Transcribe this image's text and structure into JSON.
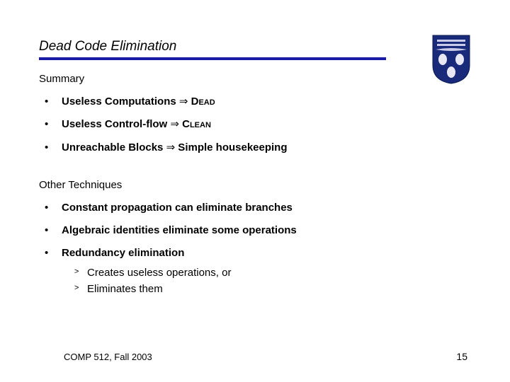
{
  "title": "Dead Code Elimination",
  "crest_label": "university-crest",
  "summary": {
    "heading": "Summary",
    "items": [
      {
        "lead": "Useless Computations ",
        "arrow": "⇒",
        "tail_sc": " Dead"
      },
      {
        "lead": "Useless Control-flow  ",
        "arrow": "⇒",
        "tail_sc": " Clean"
      },
      {
        "lead": "Unreachable Blocks  ",
        "arrow": "⇒",
        "tail": " Simple housekeeping"
      }
    ]
  },
  "other": {
    "heading": "Other Techniques",
    "items": [
      {
        "text": "Constant propagation can eliminate branches"
      },
      {
        "text": "Algebraic identities eliminate some operations"
      },
      {
        "text": "Redundancy elimination",
        "sub": [
          "Creates useless operations, or",
          "Eliminates them"
        ]
      }
    ]
  },
  "footer": {
    "left": "COMP 512, Fall 2003",
    "right": "15"
  }
}
